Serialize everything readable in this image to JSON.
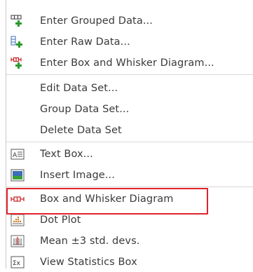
{
  "menu": {
    "items": [
      {
        "label": "Enter Grouped Data...",
        "icon": "grouped-data-add-icon"
      },
      {
        "label": "Enter Raw Data...",
        "icon": "raw-data-add-icon"
      },
      {
        "label": "Enter Box and Whisker Diagram...",
        "icon": "box-whisker-add-icon"
      },
      {
        "label": "Edit Data Set...",
        "icon": ""
      },
      {
        "label": "Group Data Set...",
        "icon": ""
      },
      {
        "label": "Delete Data Set",
        "icon": ""
      },
      {
        "label": "Text Box...",
        "icon": "text-box-icon"
      },
      {
        "label": "Insert Image...",
        "icon": "image-icon"
      },
      {
        "label": "Box and Whisker Diagram",
        "icon": "box-whisker-icon"
      },
      {
        "label": "Dot Plot",
        "icon": "dot-plot-icon"
      },
      {
        "label": "Mean ±3 std. devs.",
        "icon": "mean-std-icon"
      },
      {
        "label": "View Statistics Box",
        "icon": "statistics-sigma-icon"
      }
    ]
  },
  "colors": {
    "highlight": "#e0242a",
    "plus_green": "#2a9a2a",
    "icon_red": "#c81e1e",
    "icon_blue": "#3b6fb6"
  }
}
